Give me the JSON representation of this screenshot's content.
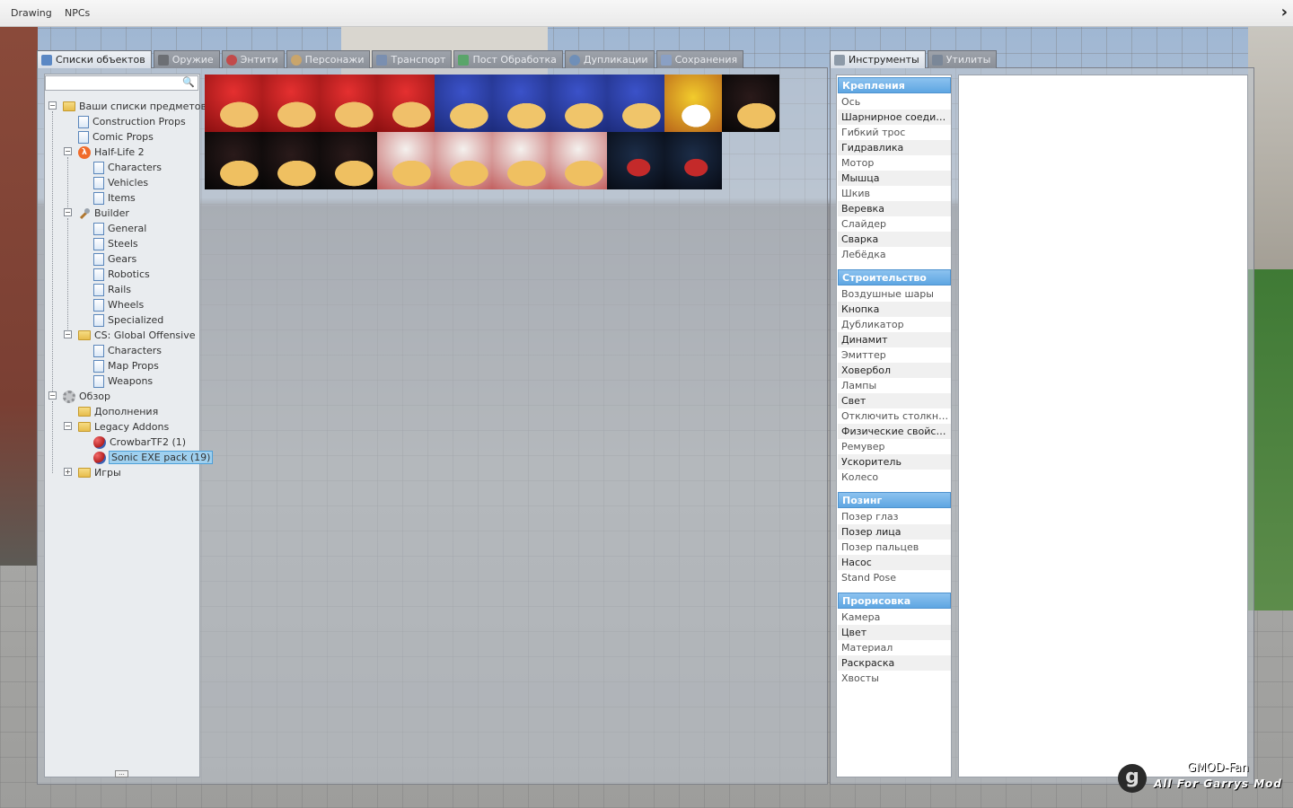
{
  "menubar": {
    "items": [
      "Drawing",
      "NPCs"
    ],
    "collapse_icon": "chevron-right-icon"
  },
  "spawn_tabs": [
    {
      "label": "Списки объектов",
      "icon": "grid-icon",
      "active": true
    },
    {
      "label": "Оружие",
      "icon": "gun-icon"
    },
    {
      "label": "Энтити",
      "icon": "entity-icon"
    },
    {
      "label": "Персонажи",
      "icon": "face-icon"
    },
    {
      "label": "Транспорт",
      "icon": "car-icon"
    },
    {
      "label": "Пост Обработка",
      "icon": "image-icon"
    },
    {
      "label": "Дупликации",
      "icon": "gmod-icon"
    },
    {
      "label": "Сохранения",
      "icon": "save-icon"
    }
  ],
  "search": {
    "value": "",
    "placeholder": ""
  },
  "tree": [
    {
      "label": "Ваши списки предметов",
      "icon": "folder"
    },
    {
      "label": "Construction Props",
      "icon": "page"
    },
    {
      "label": "Comic Props",
      "icon": "page"
    },
    {
      "label": "Half-Life 2",
      "icon": "hl2"
    },
    {
      "label": "Characters",
      "icon": "page"
    },
    {
      "label": "Vehicles",
      "icon": "page"
    },
    {
      "label": "Items",
      "icon": "page"
    },
    {
      "label": "Builder",
      "icon": "wrench"
    },
    {
      "label": "General",
      "icon": "page"
    },
    {
      "label": "Steels",
      "icon": "page"
    },
    {
      "label": "Gears",
      "icon": "page"
    },
    {
      "label": "Robotics",
      "icon": "page"
    },
    {
      "label": "Rails",
      "icon": "page"
    },
    {
      "label": "Wheels",
      "icon": "page"
    },
    {
      "label": "Specialized",
      "icon": "page"
    },
    {
      "label": "CS: Global Offensive",
      "icon": "folder"
    },
    {
      "label": "Characters",
      "icon": "page"
    },
    {
      "label": "Map Props",
      "icon": "page"
    },
    {
      "label": "Weapons",
      "icon": "page"
    },
    {
      "label": "Обзор",
      "icon": "gear"
    },
    {
      "label": "Дополнения",
      "icon": "folder"
    },
    {
      "label": "Legacy Addons",
      "icon": "folder"
    },
    {
      "label": "CrowbarTF2 (1)",
      "icon": "addon"
    },
    {
      "label": "Sonic EXE pack (19)",
      "icon": "addon",
      "selected": true
    },
    {
      "label": "Игры",
      "icon": "folder"
    }
  ],
  "spawn_icons": [
    "red",
    "red",
    "red",
    "red",
    "blue",
    "blue",
    "blue",
    "blue",
    "yellow",
    "dark",
    "dark",
    "dark",
    "dark",
    "white",
    "white",
    "white",
    "white",
    "navy",
    "navy"
  ],
  "tool_tabs": [
    {
      "label": "Инструменты",
      "icon": "wrench-icon",
      "active": true
    },
    {
      "label": "Утилиты",
      "icon": "utility-icon"
    }
  ],
  "tool_categories": [
    {
      "name": "Крепления",
      "items": [
        "Ось",
        "Шарнирное соединение",
        "Гибкий трос",
        "Гидравлика",
        "Мотор",
        "Мышца",
        "Шкив",
        "Веревка",
        "Слайдер",
        "Сварка",
        "Лебёдка"
      ]
    },
    {
      "name": "Строительство",
      "items": [
        "Воздушные шары",
        "Кнопка",
        "Дубликатор",
        "Динамит",
        "Эмиттер",
        "Ховербол",
        "Лампы",
        "Свет",
        "Отключить столкновения",
        "Физические свойства",
        "Ремувер",
        "Ускоритель",
        "Колесо"
      ]
    },
    {
      "name": "Позинг",
      "items": [
        "Позер глаз",
        "Позер лица",
        "Позер пальцев",
        "Насос",
        "Stand Pose"
      ]
    },
    {
      "name": "Прорисовка",
      "items": [
        "Камера",
        "Цвет",
        "Материал",
        "Раскраска",
        "Хвосты"
      ]
    }
  ],
  "watermark": {
    "logo": "g",
    "name": "GMOD-Fan",
    "tagline": "All For Garrys Mod"
  }
}
